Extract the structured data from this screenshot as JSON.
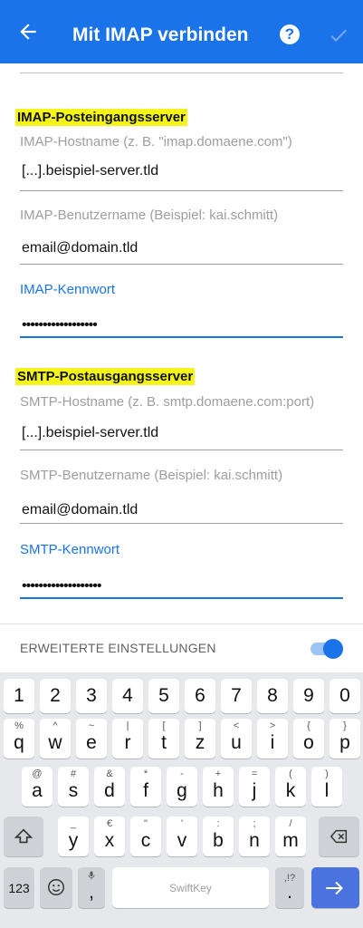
{
  "appbar": {
    "title": "Mit IMAP verbinden",
    "back_icon": "arrow-left-icon",
    "help_icon": "help-circle-icon",
    "confirm_icon": "check-icon",
    "help_glyph": "?",
    "color": "#1a73e8"
  },
  "imap": {
    "section": "IMAP-Posteingangsserver",
    "host_label": "IMAP-Hostname (z. B. \"imap.domaene.com\")",
    "host_value": "[...].beispiel-server.tld",
    "user_label": "IMAP-Benutzername (Beispiel: kai.schmitt)",
    "user_value": "email@domain.tld",
    "password_label": "IMAP-Kennwort",
    "password_value": "••••••••••••••••••"
  },
  "smtp": {
    "section": "SMTP-Postausgangsserver",
    "host_label": "SMTP-Hostname (z. B. smtp.domaene.com:port)",
    "host_value": "[...].beispiel-server.tld",
    "user_label": "SMTP-Benutzername (Beispiel: kai.schmitt)",
    "user_value": "email@domain.tld",
    "password_label": "SMTP-Kennwort",
    "password_value": "•••••••••••••••••••"
  },
  "advanced": {
    "label": "ERWEITERTE EINSTELLUNGEN",
    "toggle_on": true
  },
  "keyboard": {
    "numbers": [
      "1",
      "2",
      "3",
      "4",
      "5",
      "6",
      "7",
      "8",
      "9",
      "0"
    ],
    "row1": [
      {
        "k": "q",
        "a": "%"
      },
      {
        "k": "w",
        "a": "^"
      },
      {
        "k": "e",
        "a": "~"
      },
      {
        "k": "r",
        "a": "|"
      },
      {
        "k": "t",
        "a": "["
      },
      {
        "k": "z",
        "a": "]"
      },
      {
        "k": "u",
        "a": "<"
      },
      {
        "k": "i",
        "a": ">"
      },
      {
        "k": "o",
        "a": "{"
      },
      {
        "k": "p",
        "a": "}"
      }
    ],
    "row2": [
      {
        "k": "a",
        "a": "@"
      },
      {
        "k": "s",
        "a": "#"
      },
      {
        "k": "d",
        "a": "&"
      },
      {
        "k": "f",
        "a": "*"
      },
      {
        "k": "g",
        "a": "-"
      },
      {
        "k": "h",
        "a": "+"
      },
      {
        "k": "j",
        "a": "="
      },
      {
        "k": "k",
        "a": "("
      },
      {
        "k": "l",
        "a": ")"
      }
    ],
    "row3": [
      {
        "k": "y",
        "a": "_"
      },
      {
        "k": "x",
        "a": "€"
      },
      {
        "k": "c",
        "a": "\""
      },
      {
        "k": "v",
        "a": "'"
      },
      {
        "k": "b",
        "a": ":"
      },
      {
        "k": "n",
        "a": ";"
      },
      {
        "k": "m",
        "a": "/"
      }
    ],
    "shift_icon": "shift-icon",
    "backspace_icon": "backspace-icon",
    "symbols_label": "123",
    "emoji_icon": "emoji-icon",
    "comma_key": ",",
    "comma_alt": "mic",
    "space_label": "SwiftKey",
    "period_key": ".",
    "period_alt": ",!?",
    "enter_icon": "arrow-right-icon"
  }
}
